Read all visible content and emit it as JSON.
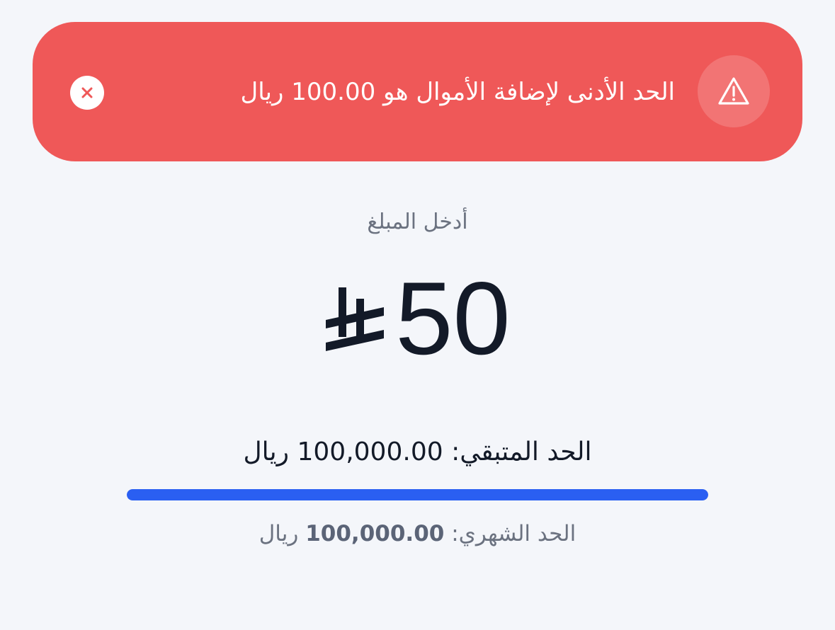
{
  "alert": {
    "message": "الحد الأدنى لإضافة الأموال هو 100.00 ريال",
    "icon": "warning-triangle-icon",
    "close_icon": "close-icon",
    "background_color": "#ef5858"
  },
  "amount": {
    "label": "أدخل المبلغ",
    "value": "50",
    "currency_icon": "saudi-riyal-icon"
  },
  "limits": {
    "remaining_label": "الحد المتبقي:",
    "remaining_value": "100,000.00",
    "remaining_currency": "ريال",
    "progress_fraction": 1.0,
    "progress_color": "#2a5ff2",
    "monthly_label": "الحد الشهري:",
    "monthly_value": "100,000.00",
    "monthly_currency": "ريال"
  }
}
